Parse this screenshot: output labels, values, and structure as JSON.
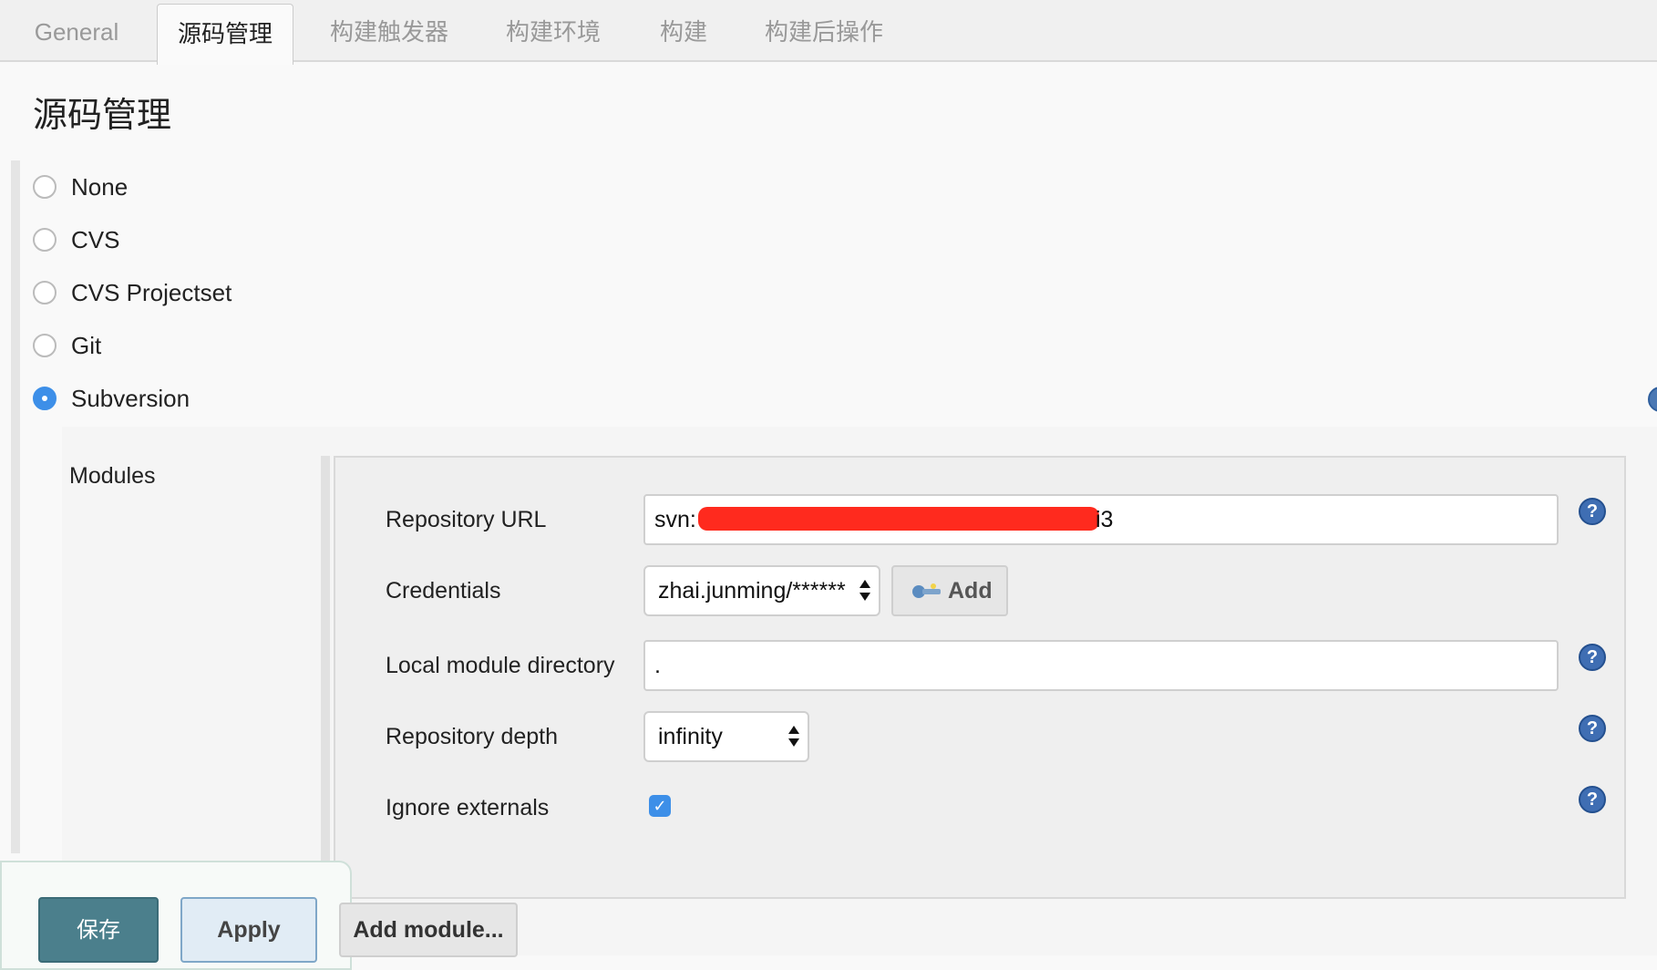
{
  "tabs": [
    {
      "label": "General",
      "active": false
    },
    {
      "label": "源码管理",
      "active": true
    },
    {
      "label": "构建触发器",
      "active": false
    },
    {
      "label": "构建环境",
      "active": false
    },
    {
      "label": "构建",
      "active": false
    },
    {
      "label": "构建后操作",
      "active": false
    }
  ],
  "section": {
    "title": "源码管理"
  },
  "scm_options": [
    {
      "label": "None",
      "selected": false
    },
    {
      "label": "CVS",
      "selected": false
    },
    {
      "label": "CVS Projectset",
      "selected": false
    },
    {
      "label": "Git",
      "selected": false
    },
    {
      "label": "Subversion",
      "selected": true
    }
  ],
  "modules": {
    "label": "Modules",
    "repository_url": {
      "label": "Repository URL",
      "value_prefix": "svn:",
      "value_suffix": "i3",
      "help_icon": "question-circle"
    },
    "credentials": {
      "label": "Credentials",
      "value": "zhai.junming/******",
      "add_label": "Add",
      "add_icon": "key-icon"
    },
    "local_module_directory": {
      "label": "Local module directory",
      "value": ".",
      "help_icon": "question-circle"
    },
    "repository_depth": {
      "label": "Repository depth",
      "value": "infinity",
      "help_icon": "question-circle"
    },
    "ignore_externals": {
      "label": "Ignore externals",
      "checked": true,
      "help_icon": "question-circle"
    },
    "add_module_label": "Add module..."
  },
  "buttons": {
    "save": "保存",
    "apply": "Apply"
  },
  "colors": {
    "accent": "#3d8fe8",
    "save_button": "#4b7f8c",
    "redaction": "#ff2a1e",
    "help_icon": "#3f6eb3"
  }
}
